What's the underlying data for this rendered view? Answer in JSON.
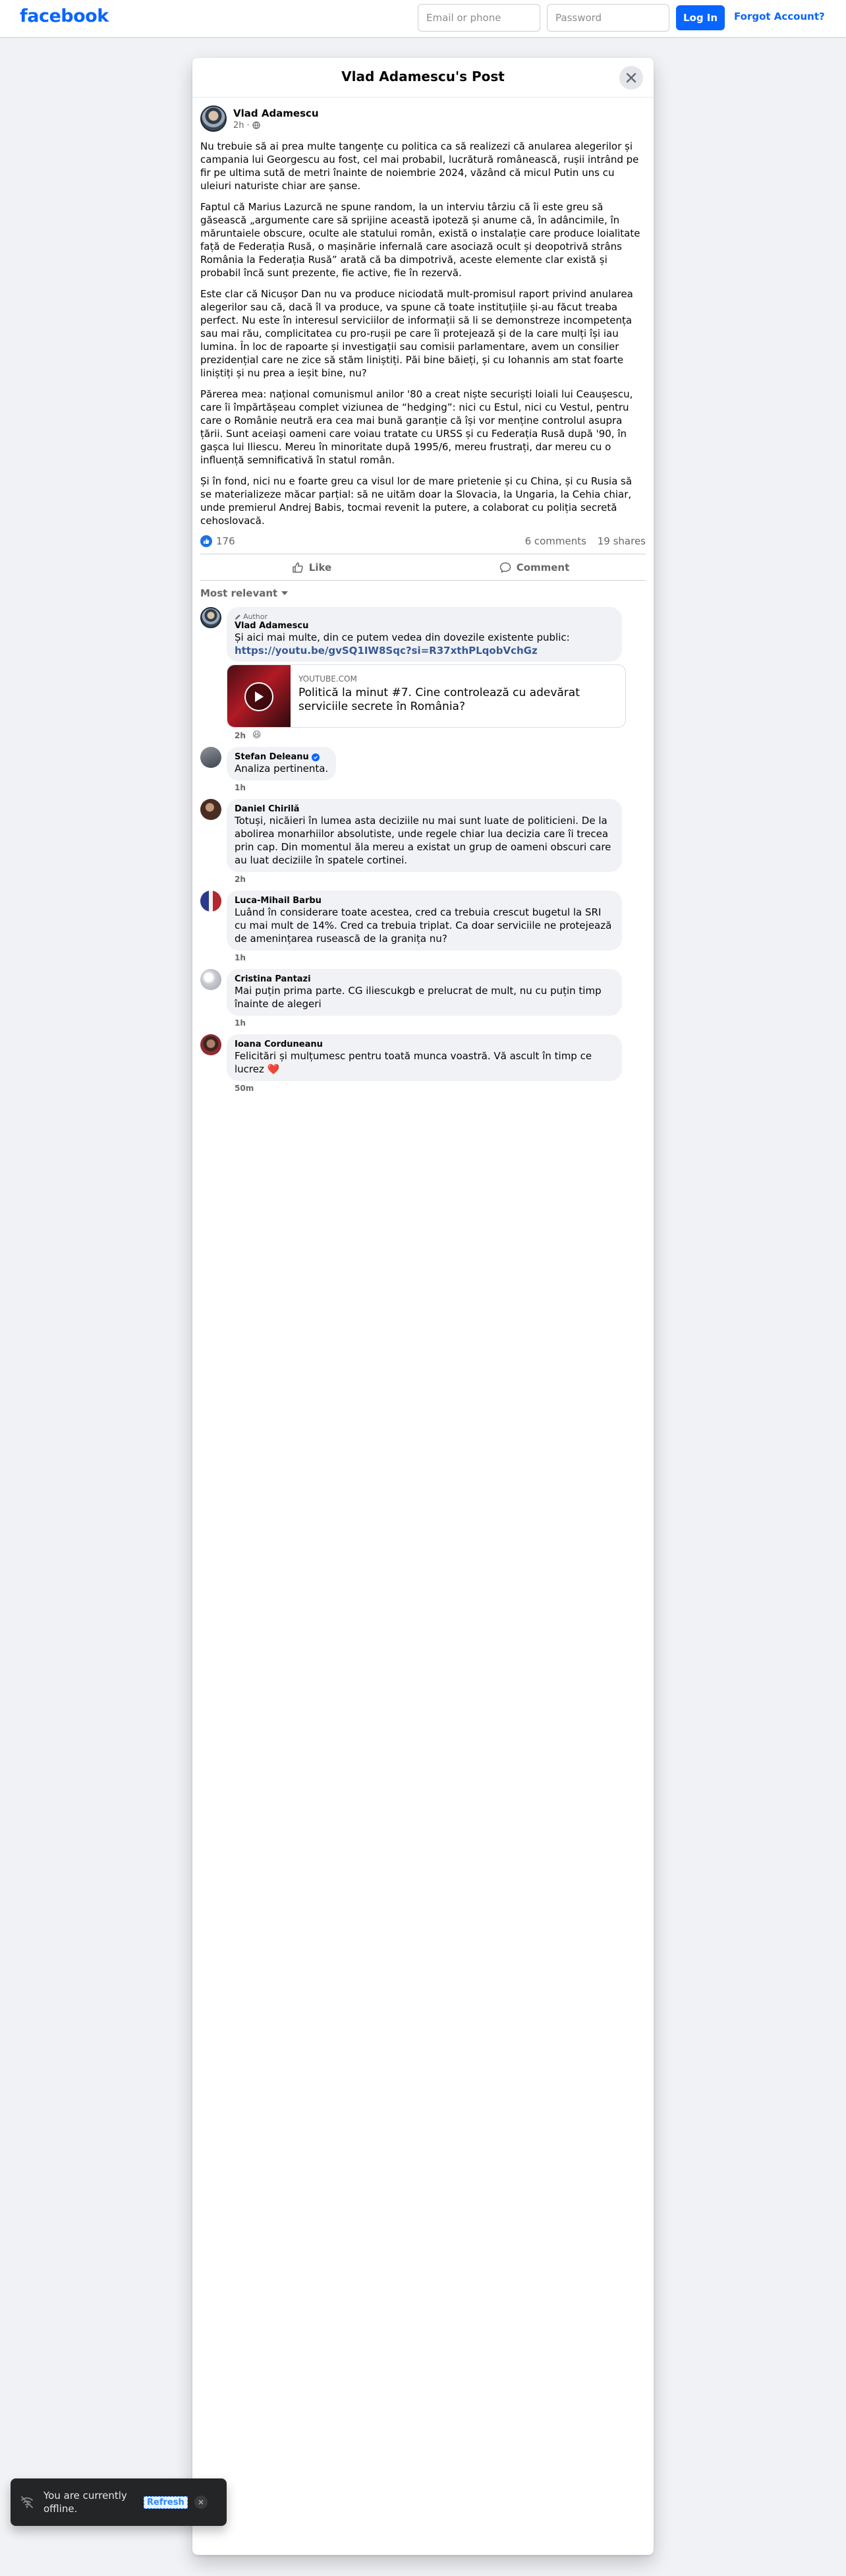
{
  "header": {
    "logo": "facebook",
    "email_placeholder": "Email or phone",
    "password_placeholder": "Password",
    "login_label": "Log In",
    "forgot_label": "Forgot Account?",
    "brand_color": "#0866ff"
  },
  "modal": {
    "title": "Vlad Adamescu's Post"
  },
  "post": {
    "author": "Vlad Adamescu",
    "time": "2h",
    "privacy_icon": "globe-icon",
    "paragraphs": [
      "Nu trebuie să ai prea multe tangențe cu politica ca să realizezi că anularea alegerilor și campania lui Georgescu au fost, cel mai probabil, lucrătură românească, rușii intrând pe fir pe ultima sută de metri înainte de noiembrie 2024, văzând că micul Putin uns cu uleiuri naturiste chiar are șanse.",
      "Faptul că Marius Lazurcă ne spune random, la un interviu târziu că îi este greu să găsească „argumente care să sprijine această ipoteză și anume că, în adâncimile, în măruntaiele obscure, oculte ale statului român, există o instalație care produce loialitate față de Federația Rusă, o mașinărie infernală care asociază ocult și deopotrivă strâns România la Federația Rusă” arată că ba dimpotrivă, aceste elemente clar există și probabil încă sunt prezente, fie active, fie în rezervă.",
      "Este clar că Nicușor Dan nu va produce niciodată mult-promisul raport privind anularea alegerilor sau că, dacă îl va produce, va spune că toate instituțiile și-au făcut treaba perfect. Nu este în interesul serviciilor de informații să li se demonstreze incompetența sau mai rău, complicitatea cu pro-rușii pe care îi protejează și de la care mulți își iau lumina. În loc de rapoarte și investigații sau comisii parlamentare, avem un consilier prezidențial care ne zice să stăm liniștiți. Păi bine băieți, și cu Iohannis am stat foarte liniștiți și nu prea a ieșit bine, nu?",
      "Părerea mea: național comunismul anilor '80 a creat niște securiști loiali lui Ceaușescu, care îi împărtășeau complet viziunea de “hedging”: nici cu Estul, nici cu Vestul, pentru care o Românie neutră era cea mai bună garanție că își vor menține controlul asupra țării. Sunt aceiași oameni care voiau tratate cu URSS și cu Federația Rusă după '90, în gașca lui Iliescu. Mereu în minoritate după 1995/6, mereu frustrați, dar mereu cu o influență semnificativă în statul român.",
      "Și în fond, nici nu e foarte greu ca visul lor de mare prietenie și cu China, și cu Rusia să se materializeze măcar parțial: să ne uităm doar la Slovacia, la Ungaria, la Cehia chiar, unde premierul Andrej Babis, tocmai revenit la putere, a colaborat cu poliția secretă cehoslovacă."
    ],
    "reactions_count": "176",
    "comments_count": "6 comments",
    "shares_count": "19 shares",
    "like_label": "Like",
    "comment_label": "Comment",
    "sort_label": "Most relevant"
  },
  "comments": [
    {
      "badge": "Author",
      "name": "Vlad Adamescu",
      "text": "Și aici mai multe, din ce putem vedea din dovezile existente public:",
      "link": "https://youtu.be/gvSQ1IW8Sqc?si=R37xthPLqobVchGz",
      "card_domain": "YOUTUBE.COM",
      "card_title": "Politică la minut #7. Cine controlează cu adevărat serviciile secrete în România?",
      "time": "2h",
      "reaction": "😆"
    },
    {
      "name": "Stefan Deleanu",
      "verified": true,
      "text": "Analiza pertinenta.",
      "time": "1h"
    },
    {
      "name": "Daniel Chirilă",
      "text": "Totuși, nicăieri în lumea asta deciziile nu mai sunt luate de politicieni. De la abolirea monarhiilor absolutiste, unde regele chiar lua decizia care îi trecea prin cap. Din momentul ăla mereu a existat un grup de oameni obscuri care au luat deciziile în spatele cortinei.",
      "time": "2h"
    },
    {
      "name": "Luca-Mihail Barbu",
      "text": "Luând în considerare toate acestea, cred ca trebuia crescut bugetul la SRI cu mai mult de 14%. Cred ca trebuia triplat. Ca doar serviciile ne protejează de amenințarea rusească de la granița nu?",
      "time": "1h"
    },
    {
      "name": "Cristina Pantazi",
      "text": "Mai puțin prima parte. CG iliescukgb e prelucrat de mult, nu cu puțin timp înainte de alegeri",
      "time": "1h"
    },
    {
      "name": "Ioana Corduneanu",
      "text": "Felicitări și mulțumesc pentru toată munca voastră. Vă ascult în timp ce lucrez ❤️",
      "time": "50m"
    }
  ],
  "toast": {
    "text": "You are currently offline.",
    "refresh_label": "Refresh"
  }
}
